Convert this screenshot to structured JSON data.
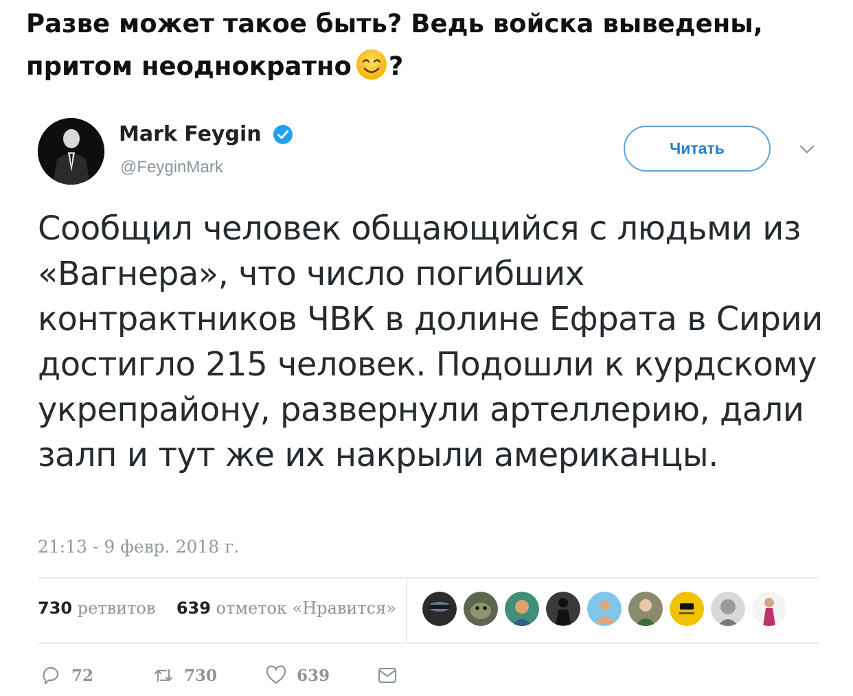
{
  "post": {
    "line1": "Разве может такое быть? Ведь войска выведены,",
    "line2": "притом неоднократно",
    "line2_end": "?"
  },
  "tweet": {
    "author_name": "Mark Feygin",
    "handle": "@FeyginMark",
    "follow_label": "Читать",
    "text": "Сообщил человек общающийся с людьми из «Вагнера», что число погибших контрактников ЧВК в долине Ефрата в Сирии достигло 215 человек. Подошли к курдскому укрепрайону, развернули артеллерию, дали залп и тут же их накрыли американцы.",
    "timestamp": "21:13 - 9 февр. 2018 г.",
    "stats": {
      "retweets_count": "730",
      "retweets_label": "ретвитов",
      "likes_count": "639",
      "likes_label": "отметок «Нравится»"
    },
    "actions": {
      "replies": "72",
      "retweets": "730",
      "likes": "639"
    }
  },
  "icons": {
    "emoji": "smiling-face-emoji",
    "verified": "verified-badge-icon",
    "chevron": "chevron-down-icon",
    "reply": "reply-icon",
    "retweet": "retweet-icon",
    "like": "heart-icon",
    "message": "envelope-icon"
  },
  "colors": {
    "accent": "#1da1f2",
    "muted": "#8a949c",
    "divider": "#e6ecf0"
  }
}
